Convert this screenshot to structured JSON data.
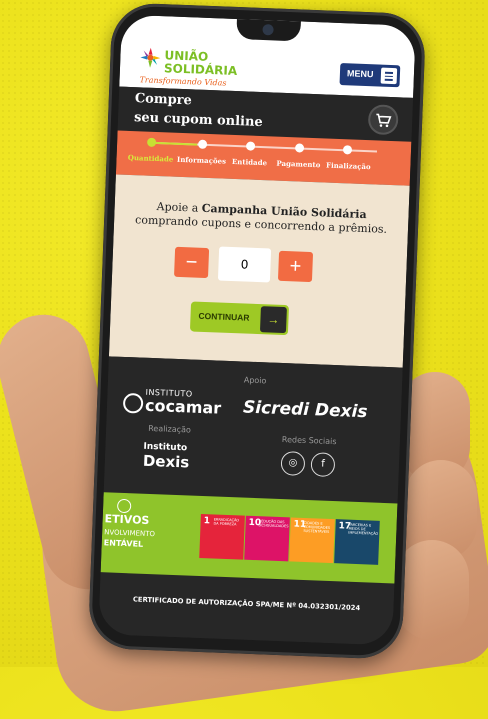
{
  "header": {
    "logo_line1": "UNIÃO",
    "logo_line2": "SOLIDÁRIA",
    "logo_tagline": "Transformando Vidas",
    "menu_label": "MENU"
  },
  "band": {
    "title_line1": "Compre",
    "title_line2": "seu cupom online"
  },
  "steps": {
    "active_index": 0,
    "items": [
      {
        "label": "Quantidade"
      },
      {
        "label": "Informações"
      },
      {
        "label": "Entidade"
      },
      {
        "label": "Pagamento"
      },
      {
        "label": "Finalização"
      }
    ]
  },
  "main": {
    "intro_pre": "Apoie a ",
    "intro_bold": "Campanha União Solidária",
    "intro_post": " comprando cupons e concorrendo a prêmios.",
    "minus_label": "−",
    "plus_label": "+",
    "quantity_value": "0",
    "continue_label": "CONTINUAR",
    "continue_arrow": "→"
  },
  "footer": {
    "apoio_label": "Apoio",
    "cocamar_line1": "INSTITUTO",
    "cocamar_line2": "cocamar",
    "sicredi": "Sicredi Dexis",
    "realizacao_label": "Realização",
    "dexis_line1": "Instituto",
    "dexis_line2": "Dexis",
    "redes_label": "Redes Sociais",
    "instagram_glyph": "◎",
    "facebook_glyph": "f",
    "ods_line1": "ETIVOS",
    "ods_line2": "NVOLVIMENTO",
    "ods_line3": "ENTÁVEL",
    "ods_tiles": [
      {
        "num": "1",
        "text": "ERRADICAÇÃO DA POBREZA",
        "color": "#e5243b"
      },
      {
        "num": "10",
        "text": "REDUÇÃO DAS DESIGUALDADES",
        "color": "#dd1367"
      },
      {
        "num": "11",
        "text": "CIDADES E COMUNIDADES SUSTENTÁVEIS",
        "color": "#fd9d24"
      },
      {
        "num": "17",
        "text": "PARCERIAS E MEIOS DE IMPLEMENTAÇÃO",
        "color": "#19486a"
      }
    ],
    "certificate": "CERTIFICADO DE AUTORIZAÇÃO SPA/ME Nº 04.032301/2024"
  }
}
